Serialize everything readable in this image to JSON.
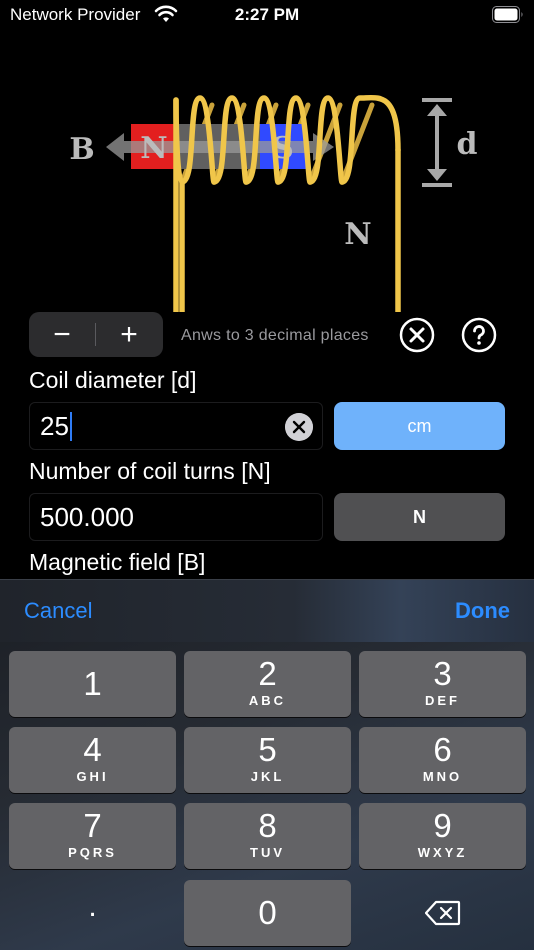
{
  "status_bar": {
    "carrier": "Network Provider",
    "time": "2:27 PM"
  },
  "diagram": {
    "label_b": "B",
    "label_n_pole": "N",
    "label_s_pole": "S",
    "label_d": "d",
    "label_n_turns": "N"
  },
  "controls": {
    "minus_label": "−",
    "plus_label": "+",
    "hint": "Anws to 3 decimal places"
  },
  "fields": {
    "coil_diameter": {
      "label": "Coil diameter [d]",
      "value": "25",
      "unit": "cm"
    },
    "coil_turns": {
      "label": "Number of coil turns [N]",
      "value": "500.000",
      "unit": "N"
    },
    "magnetic_field": {
      "label": "Magnetic field [B]"
    }
  },
  "keyboard": {
    "toolbar": {
      "cancel": "Cancel",
      "done": "Done"
    },
    "keys": [
      {
        "num": "1",
        "sub": ""
      },
      {
        "num": "2",
        "sub": "ABC"
      },
      {
        "num": "3",
        "sub": "DEF"
      },
      {
        "num": "4",
        "sub": "GHI"
      },
      {
        "num": "5",
        "sub": "JKL"
      },
      {
        "num": "6",
        "sub": "MNO"
      },
      {
        "num": "7",
        "sub": "PQRS"
      },
      {
        "num": "8",
        "sub": "TUV"
      },
      {
        "num": "9",
        "sub": "WXYZ"
      }
    ],
    "dot": ".",
    "zero": "0"
  },
  "colors": {
    "accent_blue": "#2c8cff",
    "unit_active": "#6fb2fb",
    "coil_gold": "#f0c64a",
    "magnet_north": "#e00000",
    "magnet_south": "#1432ff"
  }
}
